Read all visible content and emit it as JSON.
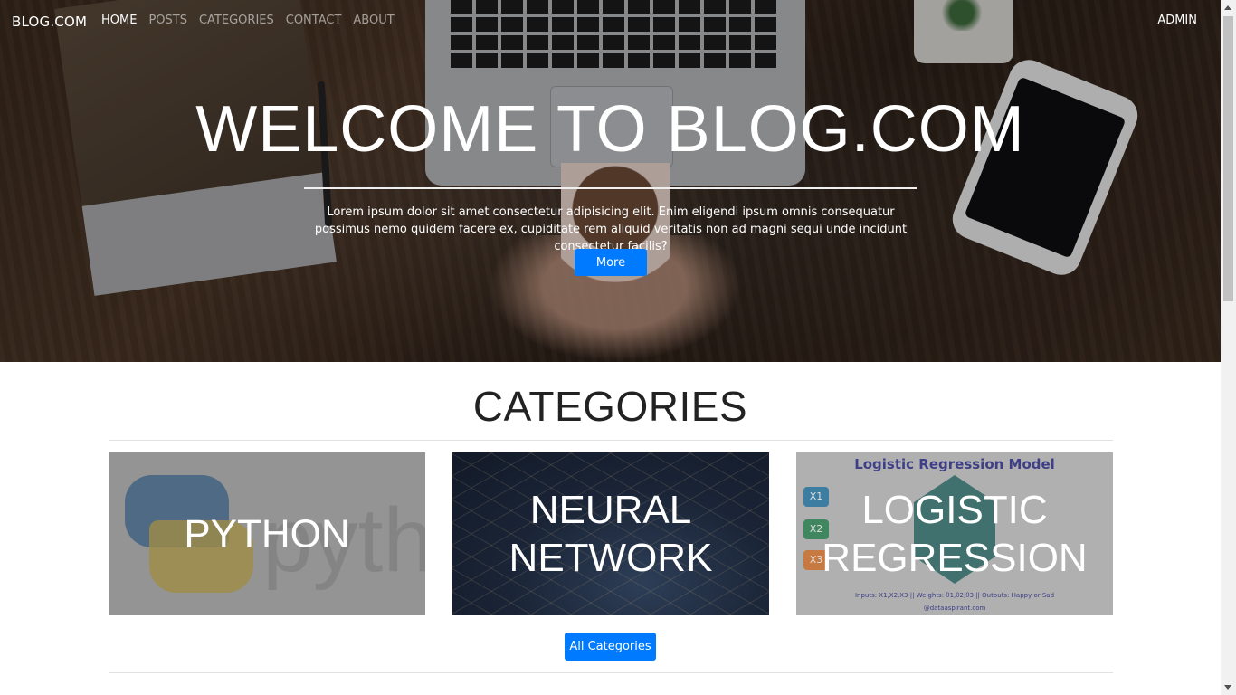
{
  "nav": {
    "brand": "BLOG.COM",
    "items": [
      {
        "label": "HOME"
      },
      {
        "label": "POSTS"
      },
      {
        "label": "CATEGORIES"
      },
      {
        "label": "CONTACT"
      },
      {
        "label": "ABOUT"
      }
    ],
    "admin": "ADMIN"
  },
  "hero": {
    "title": "WELCOME TO BLOG.COM",
    "text": "Lorem ipsum dolor sit amet consectetur adipisicing elit. Enim eligendi ipsum omnis consequatur possimus nemo quidem facere ex, cupiditate rem aliquid veritatis non ad magni sequi unde incidunt consectetur facilis?",
    "button": "More"
  },
  "categories": {
    "title": "CATEGORIES",
    "cards": [
      {
        "label": "PYTHON",
        "image_text": "pyth"
      },
      {
        "label": "NEURAL NETWORK"
      },
      {
        "label": "LOGISTIC REGRESSION",
        "image_title": "Logistic Regression Model",
        "image_nodes": [
          "X1",
          "X2",
          "X3"
        ],
        "image_footer": "Inputs: X1,X2,X3 || Weights: θ1,θ2,θ3 || Outputs: Happy or Sad",
        "image_credit": "@dataaspirant.com"
      }
    ],
    "button": "All Categories"
  },
  "colors": {
    "primary": "#007bff",
    "node_x1": "#2a7fb0",
    "node_x2": "#2e8b57",
    "node_x3": "#e07a2e"
  }
}
